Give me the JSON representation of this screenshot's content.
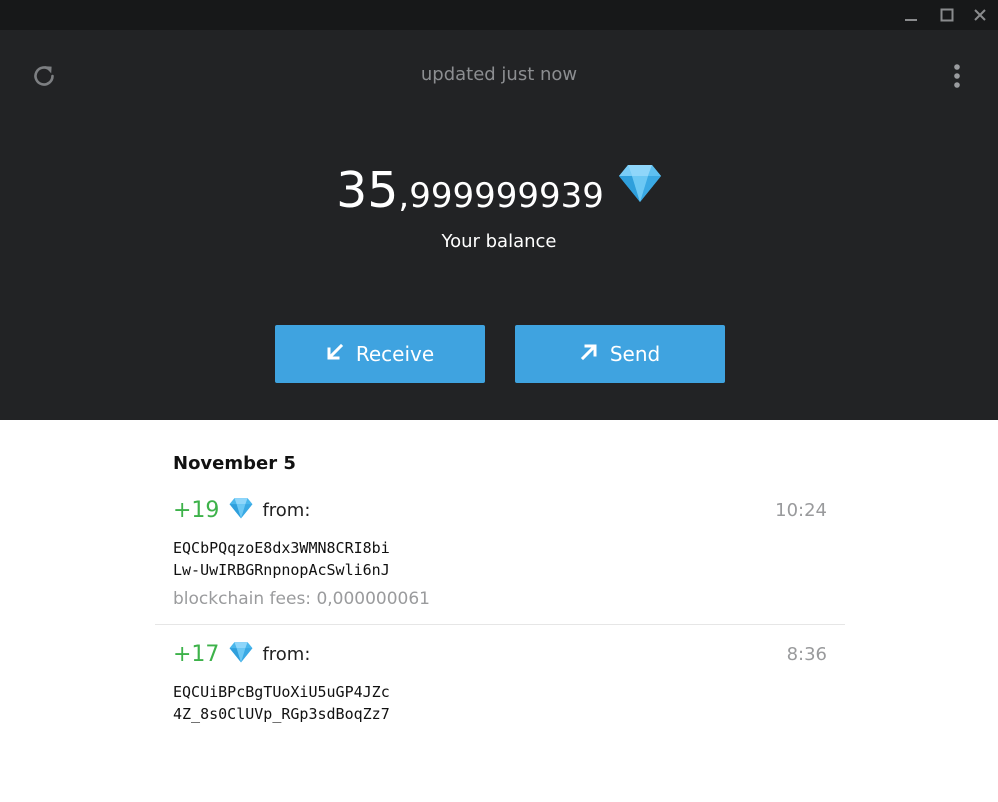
{
  "window_controls": {
    "minimize_icon": "minimize-icon",
    "maximize_icon": "maximize-icon",
    "close_icon": "close-icon"
  },
  "header": {
    "refresh_icon": "refresh-icon",
    "status": "updated just now",
    "menu_icon": "more-vertical-icon",
    "balance_integer": "35",
    "balance_fraction": ",999999939",
    "currency_icon": "diamond-icon",
    "balance_label": "Your balance",
    "receive_label": "Receive",
    "receive_icon": "arrow-down-left-icon",
    "send_label": "Send",
    "send_icon": "arrow-up-right-icon"
  },
  "transactions": {
    "date_heading": "November 5",
    "items": [
      {
        "amount": "+19",
        "direction_label": "from:",
        "time": "10:24",
        "address_line1": "EQCbPQqzoE8dx3WMN8CRI8bi",
        "address_line2": "Lw-UwIRBGRnpnopAcSwli6nJ",
        "fees": "blockchain fees: 0,000000061"
      },
      {
        "amount": "+17",
        "direction_label": "from:",
        "time": "8:36",
        "address_line1": "EQCUiBPcBgTUoXiU5uGP4JZc",
        "address_line2": "4Z_8s0ClUVp_RGp3sdBoqZz7"
      }
    ]
  },
  "colors": {
    "header_bg": "#222325",
    "titlebar_bg": "#171819",
    "button_bg": "#3fa3e0",
    "incoming_amount": "#3db24a",
    "muted_text": "#999a9c"
  }
}
